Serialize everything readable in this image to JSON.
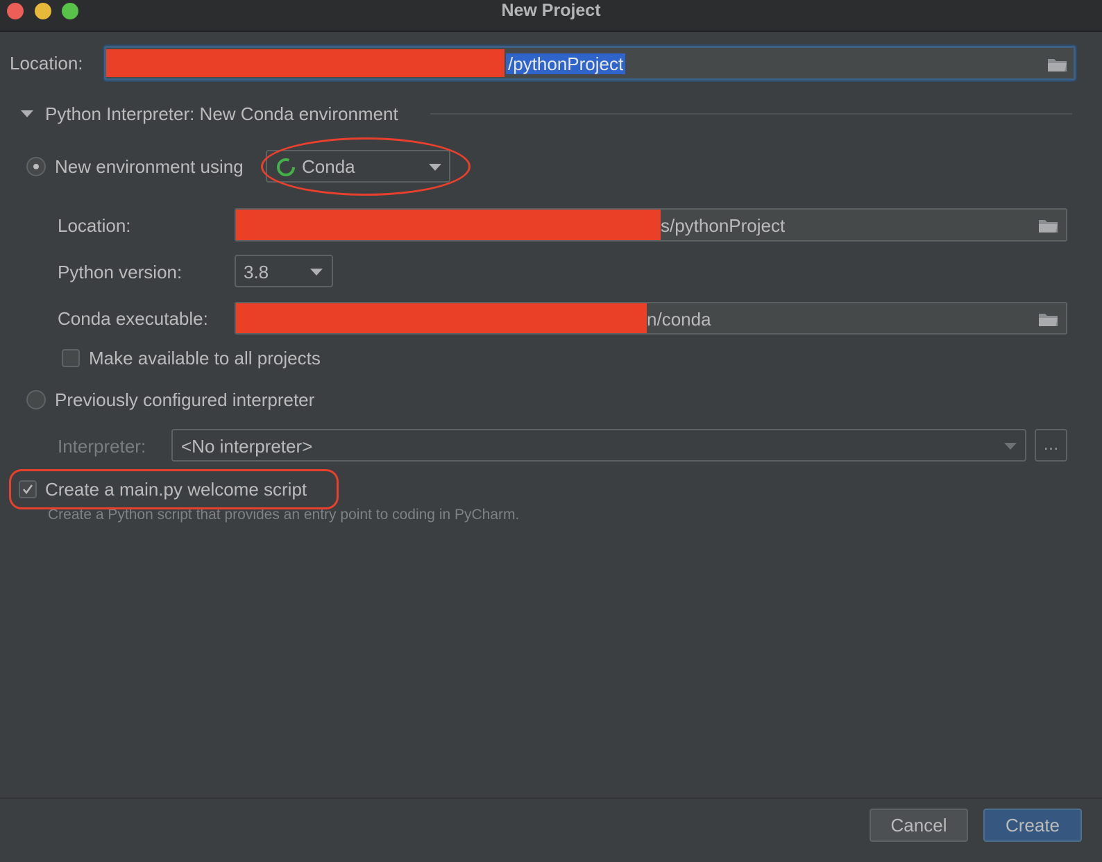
{
  "window": {
    "title": "New Project"
  },
  "project_location": {
    "label": "Location:",
    "value_visible": "/pythonProject"
  },
  "interpreter_section": {
    "header": "Python Interpreter: New Conda environment"
  },
  "new_env": {
    "radio_label": "New environment using",
    "tool": "Conda",
    "location_label": "Location:",
    "location_value_visible": "/pythonProject",
    "location_prefix_char": "s",
    "python_version_label": "Python version:",
    "python_version": "3.8",
    "conda_exe_label": "Conda executable:",
    "conda_exe_value_visible": "/conda",
    "conda_exe_prefix_char": "n",
    "make_available_label": "Make available to all projects"
  },
  "existing": {
    "radio_label": "Previously configured interpreter",
    "interpreter_label": "Interpreter:",
    "interpreter_value": "<No interpreter>",
    "browse_label": "..."
  },
  "welcome_script": {
    "label": "Create a main.py welcome script",
    "help": "Create a Python script that provides an entry point to coding in PyCharm.",
    "checked": true
  },
  "buttons": {
    "cancel": "Cancel",
    "create": "Create"
  },
  "colors": {
    "redaction": "#ea4028",
    "annotation": "#e8402c",
    "selection": "#2f65ca",
    "accent_button": "#365880"
  }
}
